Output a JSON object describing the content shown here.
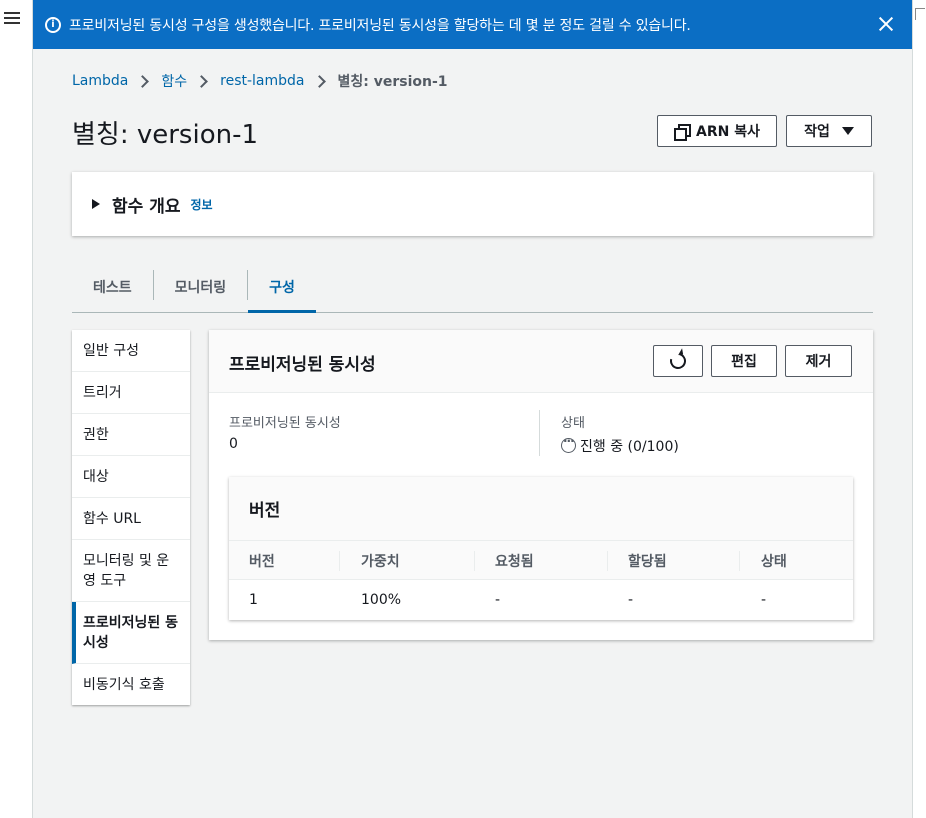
{
  "flash": {
    "message": "프로비저닝된 동시성 구성을 생성했습니다. 프로비저닝된 동시성을 할당하는 데 몇 분 정도 걸릴 수 있습니다."
  },
  "breadcrumb": {
    "items": [
      "Lambda",
      "함수",
      "rest-lambda"
    ],
    "current": "별칭: version-1"
  },
  "page": {
    "title": "별칭: version-1",
    "copy_arn_label": "ARN 복사",
    "actions_label": "작업"
  },
  "overview": {
    "title": "함수 개요",
    "info_link": "정보"
  },
  "tabs": [
    {
      "label": "테스트"
    },
    {
      "label": "모니터링"
    },
    {
      "label": "구성",
      "active": true
    }
  ],
  "sidenav": {
    "items": [
      {
        "label": "일반 구성"
      },
      {
        "label": "트리거"
      },
      {
        "label": "권한"
      },
      {
        "label": "대상"
      },
      {
        "label": "함수 URL"
      },
      {
        "label": "모니터링 및 운영 도구"
      },
      {
        "label": "프로비저닝된 동시성",
        "active": true
      },
      {
        "label": "비동기식 호출"
      }
    ]
  },
  "panel": {
    "title": "프로비저닝된 동시성",
    "edit_label": "편집",
    "remove_label": "제거",
    "concurrency_label": "프로비저닝된 동시성",
    "concurrency_value": "0",
    "status_label": "상태",
    "status_value": "진행 중 (0/100)"
  },
  "versions": {
    "title": "버전",
    "columns": [
      "버전",
      "가중치",
      "요청됨",
      "할당됨",
      "상태"
    ],
    "rows": [
      [
        "1",
        "100%",
        "-",
        "-",
        "-"
      ]
    ]
  },
  "colors": {
    "flash_bg": "#0b6ec4",
    "link": "#0066a8",
    "active_tab": "#0066a8"
  }
}
